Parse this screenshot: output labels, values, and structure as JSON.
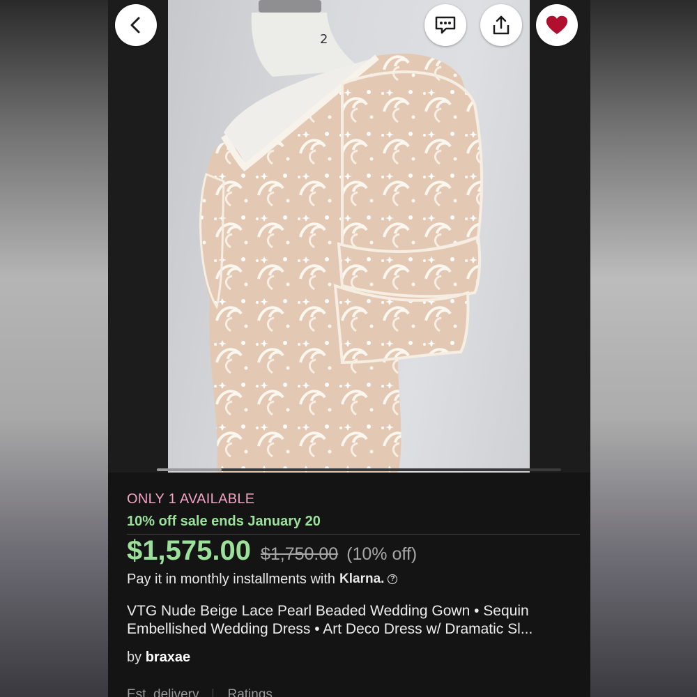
{
  "toolbar": {
    "back_icon": "chevron-left-icon",
    "message_icon": "message-icon",
    "share_icon": "share-icon",
    "favorite_icon": "heart-icon",
    "favorite_color": "#b0102e"
  },
  "gallery": {
    "progress": 0.16
  },
  "listing": {
    "availability": "ONLY 1 AVAILABLE",
    "sale_notice": "10% off sale ends January 20",
    "price": "$1,575.00",
    "original_price": "$1,750.00",
    "discount": "(10% off)",
    "installments_text": "Pay it in monthly installments with",
    "installments_provider": "Klarna.",
    "title_line_1": "VTG Nude Beige Lace Pearl Beaded Wedding Gown • Sequin",
    "title_line_2": "Embellished Wedding Dress • Art Deco Dress w/ Dramatic Sl...",
    "seller_prefix": "by",
    "seller_name": "braxae"
  },
  "footer_tabs": {
    "delivery": "Est. delivery",
    "ratings": "Ratings"
  },
  "colors": {
    "availability": "#f2a3c2",
    "sale_green": "#9be09b",
    "background": "#141414"
  }
}
